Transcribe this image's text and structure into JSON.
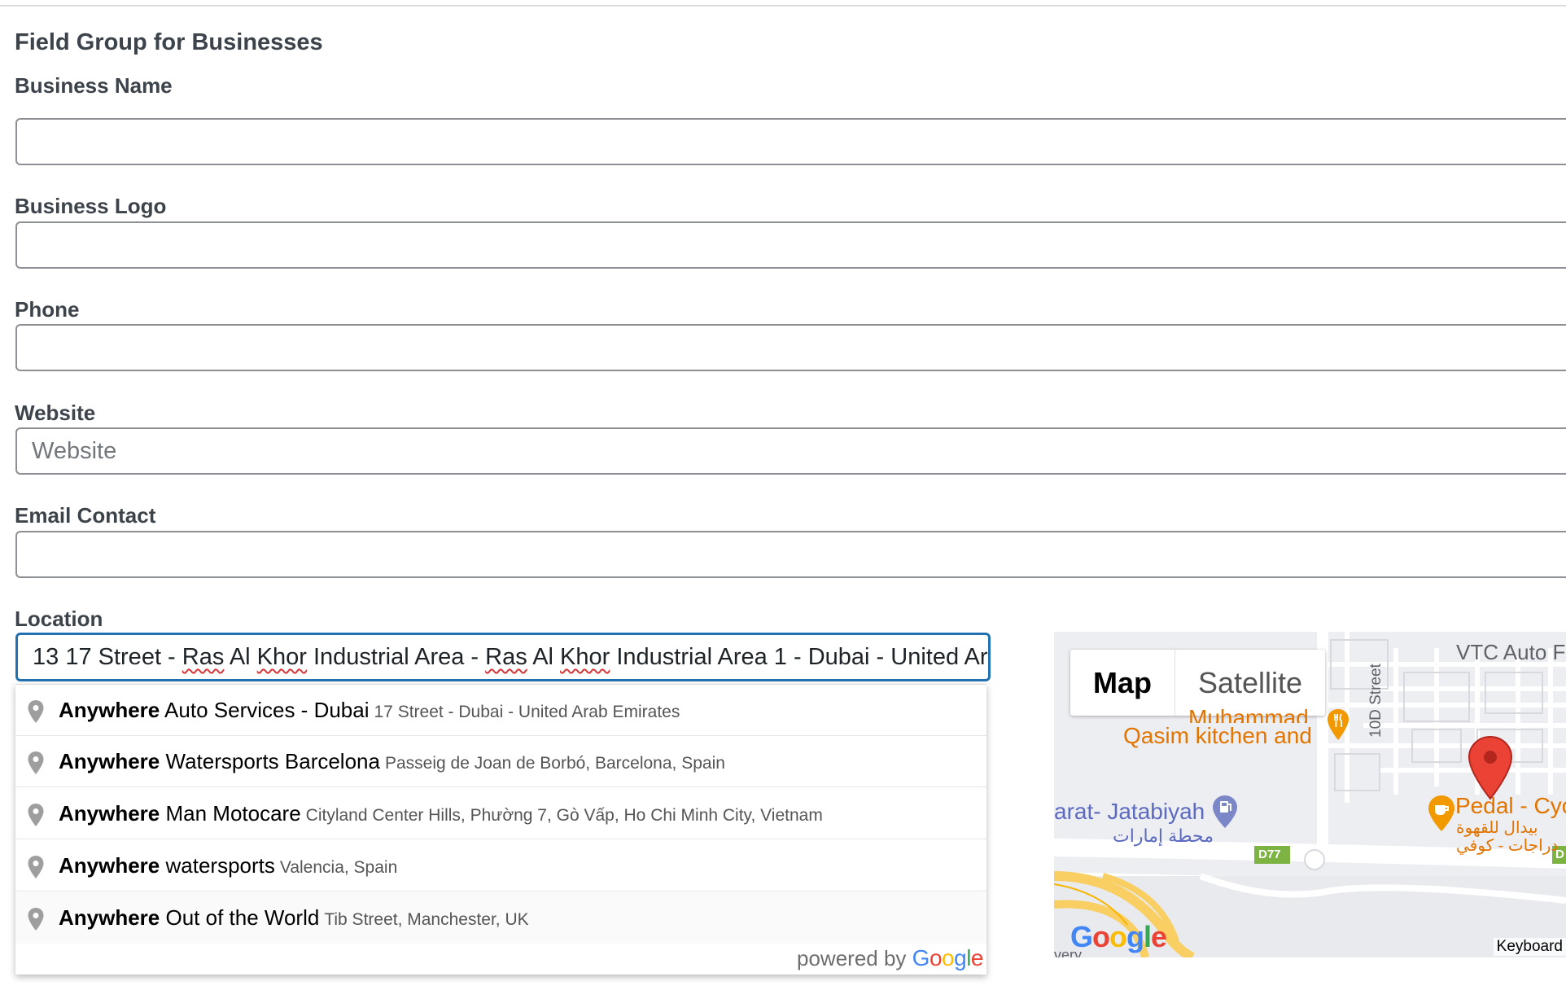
{
  "group": {
    "title": "Field Group for Businesses"
  },
  "fields": {
    "business_name": {
      "label": "Business Name",
      "value": ""
    },
    "business_logo": {
      "label": "Business Logo",
      "value": ""
    },
    "phone": {
      "label": "Phone",
      "value": ""
    },
    "website": {
      "label": "Website",
      "placeholder": "Website",
      "value": ""
    },
    "email": {
      "label": "Email Contact",
      "value": ""
    }
  },
  "location": {
    "label": "Location",
    "value_parts": [
      "13 17 Street - ",
      "Ras",
      " Al ",
      "Khor",
      " Industrial Area - ",
      "Ras",
      " Al ",
      "Khor",
      " Industrial Area 1 - Dubai - United Arab Emirates"
    ]
  },
  "autocomplete": {
    "items": [
      {
        "match": "Anywhere",
        "name": " Auto Services - Dubai",
        "address": "17 Street - Dubai - United Arab Emirates"
      },
      {
        "match": "Anywhere",
        "name": " Watersports Barcelona",
        "address": "Passeig de Joan de Borbó, Barcelona, Spain"
      },
      {
        "match": "Anywhere",
        "name": " Man Motocare",
        "address": "Cityland Center Hills, Phường 7, Gò Vấp, Ho Chi Minh City, Vietnam"
      },
      {
        "match": "Anywhere",
        "name": " watersports",
        "address": "Valencia, Spain"
      },
      {
        "match": "Anywhere",
        "name": " Out of the World",
        "address": "Tib Street, Manchester, UK"
      }
    ],
    "powered_by": "powered by",
    "google_letters": [
      "G",
      "o",
      "o",
      "g",
      "l",
      "e"
    ]
  },
  "map": {
    "map_type_map": "Map",
    "map_type_satellite": "Satellite",
    "labels": {
      "vtc": "VTC Auto F",
      "muhammad": "Muhammad",
      "qasim": "Qasim kitchen and",
      "street_10d": "10D Street",
      "jatabiyah": "arat- Jatabiyah",
      "emarat_ar": "محطة إمارات",
      "pedal": "Pedal - Cyc",
      "pedal_ar1": "بيدال للقهوة",
      "pedal_ar2": "دراجات - كوفي",
      "road_d77": "D77",
      "road_d": "D",
      "partial": "very"
    },
    "keyboard": "Keyboard",
    "google_letters": [
      "G",
      "o",
      "o",
      "g",
      "l",
      "e"
    ]
  },
  "colors": {
    "accent": "#2271b1",
    "label": "#3c434a",
    "map_pin": "#ea4335",
    "food_poi": "#f29900",
    "fuel_poi": "#7c87c8",
    "road_yellow": "#f9cf63",
    "google_blue": "#4285f4",
    "google_red": "#ea4335",
    "google_yellow": "#fbbc05",
    "google_green": "#34a853"
  },
  "icons": {
    "suggestion": "map-pin-icon",
    "marker": "location-marker-icon",
    "restaurant": "restaurant-icon",
    "fuel": "fuel-station-icon",
    "cafe": "cafe-icon"
  }
}
